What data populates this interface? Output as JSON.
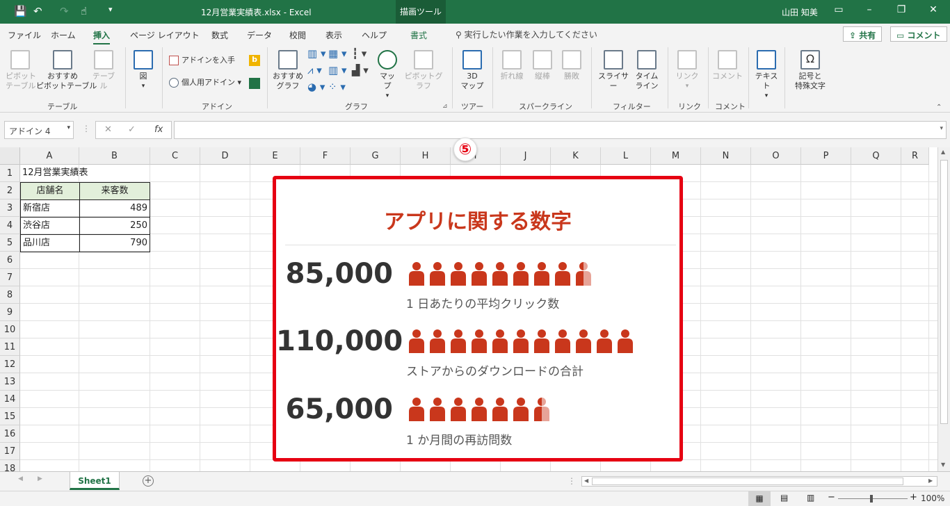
{
  "window": {
    "doc_title": "12月営業実績表.xlsx  -  Excel",
    "tools_tab": "描画ツール",
    "user": "山田 知美"
  },
  "ribbon_tabs": [
    "ファイル",
    "ホーム",
    "挿入",
    "ページ レイアウト",
    "数式",
    "データ",
    "校閲",
    "表示",
    "ヘルプ",
    "書式"
  ],
  "tell_me": "実行したい作業を入力してください",
  "share_label": "共有",
  "comment_label": "コメント",
  "ribbon": {
    "pivot": "ピボット\nテーブル",
    "recommended_pivot": "おすすめ\nピボットテーブル",
    "table": "テーブル",
    "illustrations": "図",
    "get_addin": "アドインを入手",
    "my_addin": "個人用アドイン",
    "recommended_chart": "おすすめ\nグラフ",
    "map": "マップ",
    "pivot_chart": "ピボットグラフ",
    "map3d": "3D\nマップ",
    "line": "折れ線",
    "column": "縦棒",
    "winloss": "勝敗",
    "slicer": "スライサー",
    "timeline": "タイム\nライン",
    "link": "リンク",
    "comment": "コメント",
    "text": "テキスト",
    "symbols": "記号と\n特殊文字",
    "groups": {
      "table": "テーブル",
      "addin": "アドイン",
      "chart": "グラフ",
      "tour": "ツアー",
      "sparkline": "スパークライン",
      "filter": "フィルター",
      "link": "リンク",
      "comment": "コメント"
    }
  },
  "name_box": "アドイン 4",
  "fx": "fx",
  "columns": [
    "A",
    "B",
    "C",
    "D",
    "E",
    "F",
    "G",
    "H",
    "I",
    "J",
    "K",
    "L",
    "M",
    "N",
    "O",
    "P",
    "Q",
    "R"
  ],
  "rows": [
    "1",
    "2",
    "3",
    "4",
    "5",
    "6",
    "7",
    "8",
    "9",
    "10",
    "11",
    "12",
    "13",
    "14",
    "15",
    "16",
    "17",
    "18"
  ],
  "sheet": {
    "title": "12月営業実績表",
    "header": [
      "店舗名",
      "来客数"
    ],
    "data": [
      [
        "新宿店",
        "489"
      ],
      [
        "渋谷店",
        "250"
      ],
      [
        "品川店",
        "790"
      ]
    ]
  },
  "step_badge": "⑤",
  "infographic": {
    "title": "アプリに関する数字",
    "accent": "#c9371c",
    "stats": [
      {
        "number": "85,000",
        "label": "1 日あたりの平均クリック数",
        "icons": 8.5
      },
      {
        "number": "110,000",
        "label": "ストアからのダウンロードの合計",
        "icons": 11
      },
      {
        "number": "65,000",
        "label": "1 か月間の再訪問数",
        "icons": 6.5
      }
    ]
  },
  "sheet_tab": "Sheet1",
  "zoom": "100%"
}
